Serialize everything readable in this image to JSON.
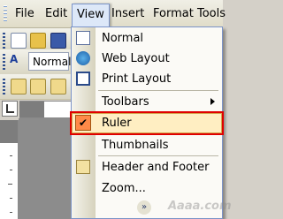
{
  "menubar": {
    "items": [
      {
        "label": "File",
        "key": "F"
      },
      {
        "label": "Edit",
        "key": "E"
      },
      {
        "label": "View",
        "key": "V"
      },
      {
        "label": "Insert",
        "key": "I"
      },
      {
        "label": "Format",
        "key": "o"
      },
      {
        "label": "Tools",
        "key": "T"
      }
    ],
    "active": "View"
  },
  "toolbar": {
    "style_value": "Normal"
  },
  "view_menu": {
    "items": [
      {
        "label": "Normal",
        "icon": "normal-view-icon"
      },
      {
        "label": "Web Layout",
        "icon": "web-layout-icon"
      },
      {
        "label": "Print Layout",
        "icon": "print-layout-icon"
      },
      {
        "label": "Toolbars",
        "icon": "",
        "submenu": true
      },
      {
        "label": "Ruler",
        "icon": "checkmark-icon",
        "checked": true,
        "highlighted": true
      },
      {
        "label": "Thumbnails",
        "icon": ""
      },
      {
        "label": "Header and Footer",
        "icon": "header-footer-icon"
      },
      {
        "label": "Zoom...",
        "icon": ""
      }
    ],
    "expand_icon": "chevron-double-down-icon"
  },
  "colors": {
    "highlight": "#ffeec2",
    "check": "#ff8a48",
    "callout": "#e00000"
  },
  "watermark": "Aaaa.com"
}
